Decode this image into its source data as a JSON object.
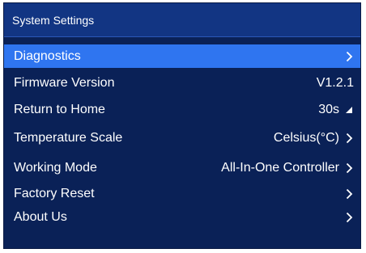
{
  "window": {
    "title": "System Settings"
  },
  "menu": {
    "items": [
      {
        "label": "Diagnostics",
        "value": "",
        "indicator": "chevron-right-icon",
        "selected": true
      },
      {
        "label": "Firmware Version",
        "value": "V1.2.1",
        "indicator": "",
        "selected": false
      },
      {
        "label": "Return to Home",
        "value": "30s",
        "indicator": "triangle-corner-icon",
        "selected": false
      },
      {
        "label": "Temperature Scale",
        "value": "Celsius(°C)",
        "indicator": "chevron-right-icon",
        "selected": false
      },
      {
        "label": "Working Mode",
        "value": "All-In-One Controller",
        "indicator": "chevron-right-icon",
        "selected": false
      },
      {
        "label": "Factory Reset",
        "value": "",
        "indicator": "chevron-right-icon",
        "selected": false
      },
      {
        "label": "About Us",
        "value": "",
        "indicator": "chevron-right-icon",
        "selected": false
      }
    ]
  },
  "colors": {
    "background": "#0a2157",
    "title_bar": "#123583",
    "selected_row": "#2f75f0",
    "text": "#ffffff"
  }
}
